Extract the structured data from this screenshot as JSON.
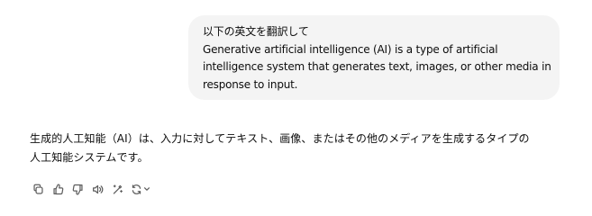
{
  "conversation": {
    "user_message": {
      "lines": [
        "以下の英文を翻訳して",
        "Generative artificial intelligence (AI) is a type of artificial",
        "intelligence system that generates text, images, or other media in",
        "response to input."
      ]
    },
    "assistant_message": {
      "lines": [
        "生成的人工知能（AI）は、入力に対してテキスト、画像、またはその他のメディアを生成するタイプの",
        "人工知能システムです。"
      ]
    },
    "actions": [
      {
        "icon": "copy-icon"
      },
      {
        "icon": "thumbs-up-icon"
      },
      {
        "icon": "thumbs-down-icon"
      },
      {
        "icon": "read-aloud-icon"
      },
      {
        "icon": "edit-wand-icon"
      },
      {
        "icon": "regenerate-icon"
      }
    ]
  }
}
